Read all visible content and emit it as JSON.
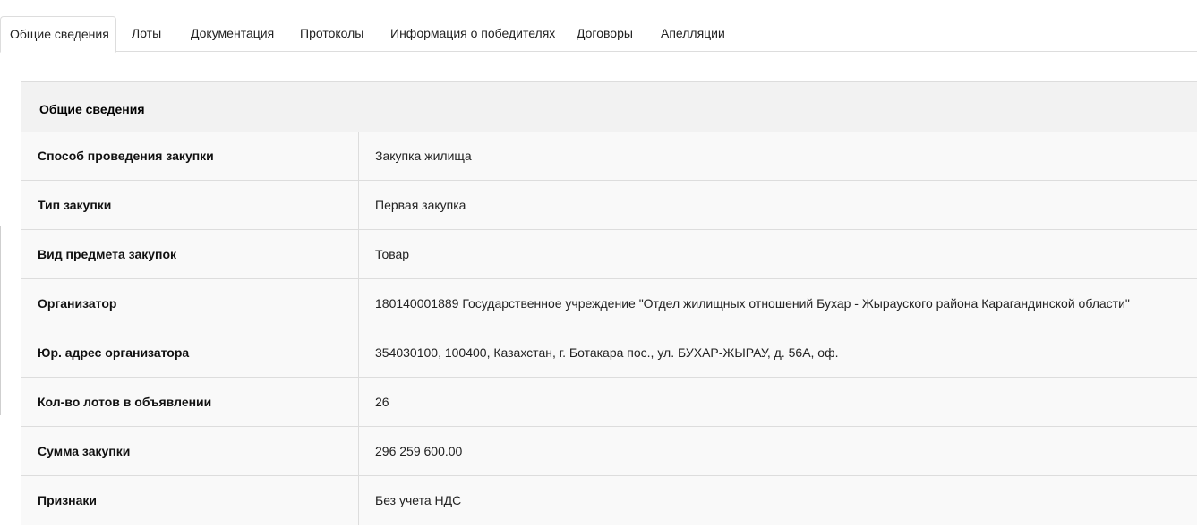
{
  "tabs": [
    {
      "label": "Общие сведения",
      "active": true
    },
    {
      "label": "Лоты",
      "active": false
    },
    {
      "label": "Документация",
      "active": false
    },
    {
      "label": "Протоколы",
      "active": false
    },
    {
      "label": "Информация о победителях",
      "active": false
    },
    {
      "label": "Договоры",
      "active": false
    },
    {
      "label": "Апелляции",
      "active": false
    }
  ],
  "panel": {
    "title": "Общие сведения",
    "rows": [
      {
        "label": "Способ проведения закупки",
        "value": "Закупка жилища"
      },
      {
        "label": "Тип закупки",
        "value": "Первая закупка"
      },
      {
        "label": "Вид предмета закупок",
        "value": "Товар"
      },
      {
        "label": "Организатор",
        "value": "180140001889 Государственное учреждение \"Отдел жилищных отношений Бухар - Жырауского района Карагандинской области\""
      },
      {
        "label": "Юр. адрес организатора",
        "value": "354030100, 100400, Казахстан, г. Ботакара пос., ул. БУХАР-ЖЫРАУ, д. 56А, оф."
      },
      {
        "label": "Кол-во лотов в объявлении",
        "value": "26"
      },
      {
        "label": "Сумма закупки",
        "value": "296 259 600.00"
      },
      {
        "label": "Признаки",
        "value": "Без учета НДС"
      }
    ]
  }
}
